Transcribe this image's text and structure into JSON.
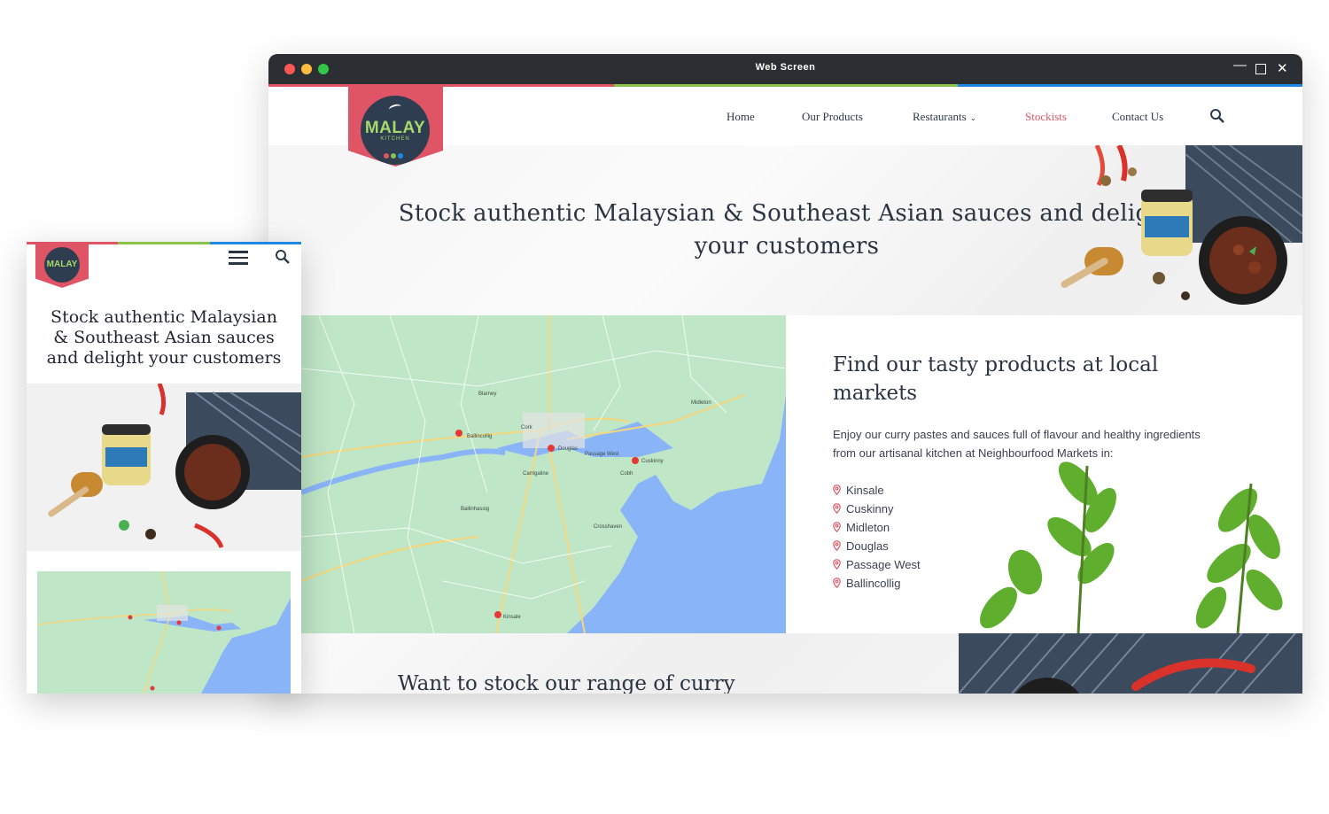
{
  "window": {
    "title": "Web Screen",
    "controls": [
      "minimize",
      "maximize",
      "close"
    ]
  },
  "brand": {
    "logo_text": "MALAY",
    "logo_subtext": "KITCHEN",
    "accent": "#e05565",
    "stripe_colors": [
      "#e05565",
      "#8bc34a",
      "#1e88e5"
    ]
  },
  "nav": {
    "items": [
      {
        "label": "Home",
        "active": false
      },
      {
        "label": "Our Products",
        "active": false
      },
      {
        "label": "Restaurants",
        "active": false,
        "has_dropdown": true
      },
      {
        "label": "Stockists",
        "active": true
      },
      {
        "label": "Contact Us",
        "active": false
      }
    ],
    "search_icon": "search-icon"
  },
  "hero": {
    "title": "Stock authentic Malaysian & Southeast Asian sauces and delight your customers"
  },
  "map": {
    "places": [
      "Ballincollig",
      "Cork",
      "Douglas",
      "Cuskinny",
      "Kinsale",
      "Passage West",
      "Cobh",
      "Carrigaline",
      "Midleton",
      "Blarney",
      "Ballinhassig",
      "Crosshaven"
    ]
  },
  "markets": {
    "title": "Find our tasty products at local markets",
    "description": "Enjoy our curry pastes and sauces full of flavour and healthy ingredients from our artisanal kitchen at Neighbourfood Markets in:",
    "locations": [
      "Kinsale",
      "Cuskinny",
      "Midleton",
      "Douglas",
      "Passage West",
      "Ballincollig"
    ]
  },
  "bottom": {
    "title": "Want to stock our range of curry"
  },
  "mobile": {
    "title": "Stock authentic Malaysian & Southeast Asian sauces and delight your customers",
    "logo_text": "MALAY",
    "menu_icon": "hamburger-icon",
    "search_icon": "search-icon"
  }
}
